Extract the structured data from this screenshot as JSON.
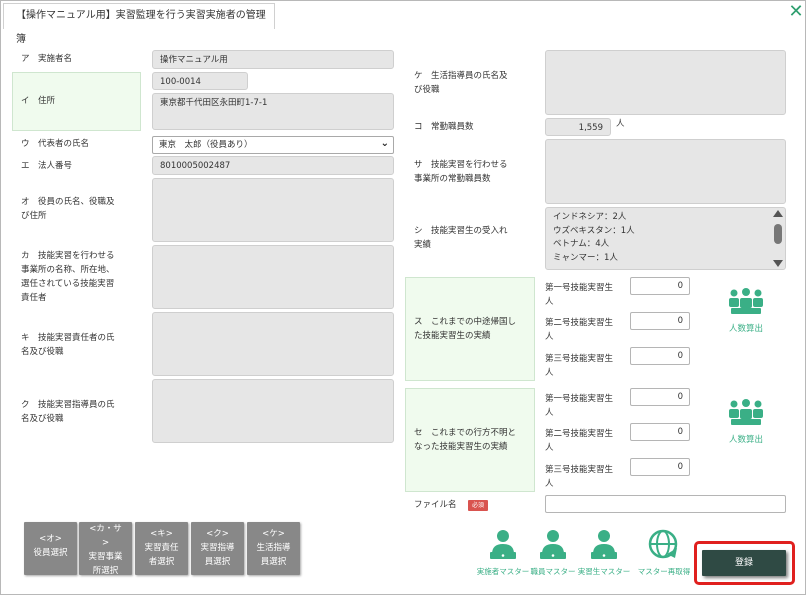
{
  "window": {
    "title": "【操作マニュアル用】実習監理を行う実習実施者の管理簿",
    "close_glyph": "✕"
  },
  "left": {
    "a_label": "ア　実施者名",
    "a_value": "操作マニュアル用",
    "i_label": "イ　住所",
    "postal": "100-0014",
    "address": "東京都千代田区永田町1-7-1",
    "u_label": "ウ　代表者の氏名",
    "u_value": "東京　太郎（役員あり）",
    "e_label": "エ　法人番号",
    "e_value": "8010005002487",
    "o_label_1": "オ　役員の氏名、役職及",
    "o_label_2": "び住所",
    "ka_label_1": "カ　技能実習を行わせる",
    "ka_label_2": "事業所の名称、所在地、",
    "ka_label_3": "選任されている技能実習",
    "ka_label_4": "責任者",
    "ki_label_1": "キ　技能実習責任者の氏",
    "ki_label_2": "名及び役職",
    "ku_label_1": "ク　技能実習指導員の氏",
    "ku_label_2": "名及び役職"
  },
  "right": {
    "ke_label_1": "ケ　生活指導員の氏名及",
    "ke_label_2": "び役職",
    "ko_label": "コ　常勤職員数",
    "ko_value": "1,559",
    "ko_unit": "人",
    "sa_label_1": "サ　技能実習を行わせる",
    "sa_label_2": "事業所の常勤職員数",
    "shi_label_1": "シ　技能実習生の受入れ",
    "shi_label_2": "実績",
    "shi_list": [
      "インドネシア：2人",
      "ウズベキスタン：1人",
      "ベトナム：4人",
      "ミャンマー：1人"
    ],
    "su_label_1": "ス　これまでの中途帰国し",
    "su_label_2": "た技能実習生の実績",
    "se_label_1": "セ　これまでの行方不明と",
    "se_label_2": "なった技能実習生の実績",
    "grade1_a": "第一号技能実習生",
    "grade2_a": "第二号技能実習生",
    "grade3_a": "第三号技能実習生",
    "person_unit": "人",
    "su_counts": [
      "0",
      "0",
      "0"
    ],
    "se_counts": [
      "0",
      "0",
      "0"
    ],
    "calc_label": "人数算出",
    "file_label": "ファイル名",
    "required_badge": "必須"
  },
  "buttons": {
    "o": [
      "<オ>",
      "役員選択"
    ],
    "ka": [
      "<カ・サ",
      ">",
      "実習事業",
      "所選択"
    ],
    "ki": [
      "<キ>",
      "実習責任",
      "者選択"
    ],
    "ku": [
      "<ク>",
      "実習指導",
      "員選択"
    ],
    "ke": [
      "<ケ>",
      "生活指導",
      "員選択"
    ]
  },
  "masters": {
    "m1": "実施者マスター",
    "m2": "職員マスター",
    "m3": "実習生マスター",
    "m4": "マスター再取得"
  },
  "register": "登録",
  "colors": {
    "accent": "#3aaf86",
    "highlight": "#e0201e",
    "register_bg": "#2f4a44"
  }
}
